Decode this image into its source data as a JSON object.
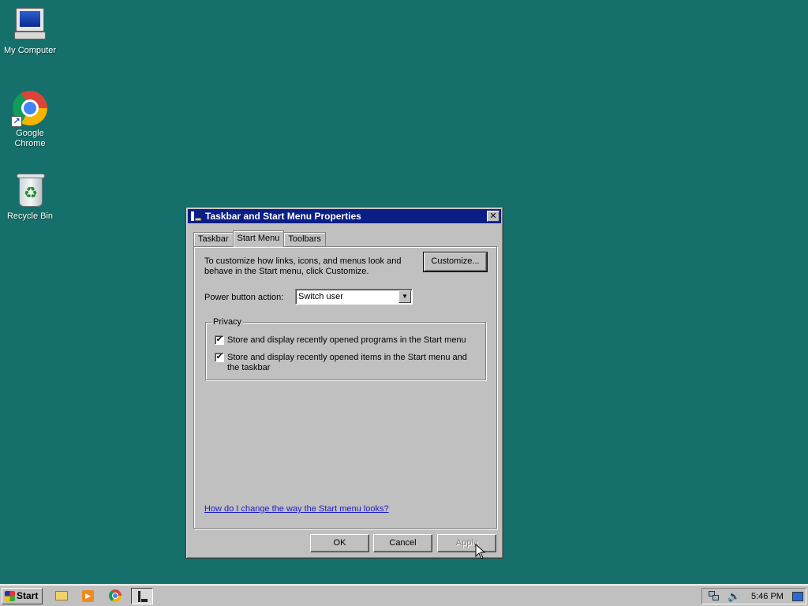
{
  "desktop": {
    "icons": [
      {
        "label": "My Computer"
      },
      {
        "label": "Google Chrome"
      },
      {
        "label": "Recycle Bin"
      }
    ]
  },
  "dialog": {
    "title": "Taskbar and Start Menu Properties",
    "close_glyph": "✕",
    "tabs": [
      "Taskbar",
      "Start Menu",
      "Toolbars"
    ],
    "active_tab": "Start Menu",
    "description": "To customize how links, icons, and menus look and behave in the Start menu, click Customize.",
    "customize_label": "Customize...",
    "power_label": "Power button action:",
    "power_value": "Switch user",
    "privacy_title": "Privacy",
    "privacy_items": [
      {
        "label": "Store and display recently opened programs in the Start menu",
        "checked": true
      },
      {
        "label": "Store and display recently opened items in the Start menu and the taskbar",
        "checked": true
      }
    ],
    "check_glyph": "✔",
    "help_link": "How do I change the way the Start menu looks?",
    "buttons": {
      "ok": "OK",
      "cancel": "Cancel",
      "apply": "Apply"
    }
  },
  "taskbar": {
    "start_label": "Start",
    "quick_launch": [
      "folder-icon",
      "media-player-icon",
      "chrome-icon",
      "taskbar-properties-icon"
    ],
    "clock": "5:46 PM"
  },
  "colors": {
    "desktop": "#156f6a",
    "title_bar": "#0a1e86",
    "face": "#c0c0c0",
    "link": "#1c1ccc"
  }
}
